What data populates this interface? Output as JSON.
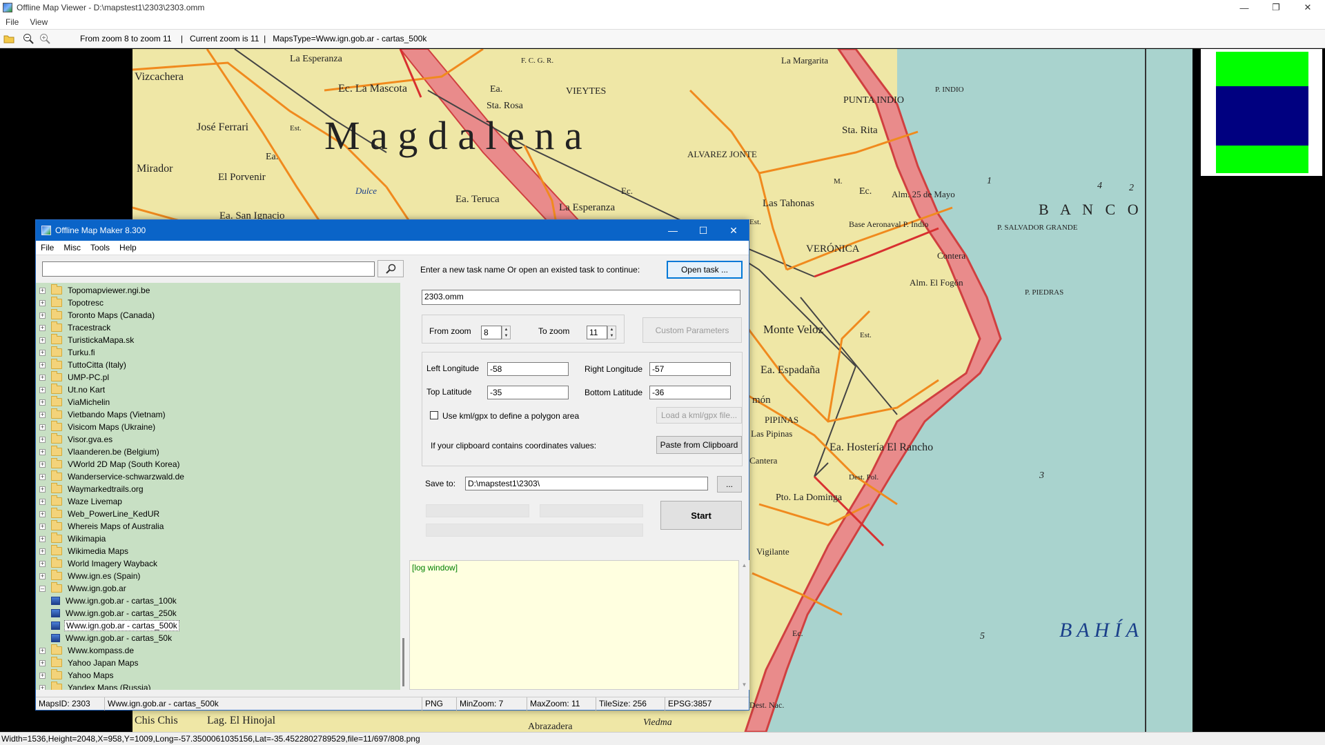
{
  "viewer": {
    "title": "Offline Map Viewer - D:\\mapstest1\\2303\\2303.omm",
    "menu": [
      "File",
      "View"
    ],
    "toolbar_status": "From zoom 8 to zoom 11    |   Current zoom is 11  |   MapsType=Www.ign.gob.ar - cartas_500k",
    "statusbar": "Width=1536,Height=2048,X=958,Y=1009,Long=-57.3500061035156,Lat=-35.4522802789529,file=11/697/808.png"
  },
  "map_labels": {
    "magdalena": "M   a   g   d   a   l   e   n   a",
    "banco": "B  A  N  C  O",
    "bahia": "B  A  H  Í  A",
    "places": [
      "La Esperanza",
      "Vizcachera",
      "Ec. La Mascota",
      "José Ferrari",
      "Mirador",
      "El Porvenir",
      "Ea. San Ignacio",
      "Ea. Teruca",
      "La Esperanza",
      "VIEYTES",
      "Sta. Rosa",
      "Ea.",
      "ALVAREZ JONTE",
      "La Margarita",
      "PUNTA INDIO",
      "P. INDIO",
      "Sta. Rita",
      "Las Tahonas",
      "Ec.",
      "Alm. 25 de Mayo",
      "Base Aeronaval P. Indio",
      "P. SALVADOR GRANDE",
      "VERÓNICA",
      "Contera",
      "Alm. El Fogón",
      "P. PIEDRAS",
      "Monte Veloz",
      "Ea. Espadaña",
      "món",
      "PIPINAS",
      "Las Pipinas",
      "Cantera",
      "Ea. Hostería El Rancho",
      "Dest. Pol.",
      "Pto. La Dominga",
      "Vigilante",
      "Ec.",
      "Chis Chis",
      "Lag. El Hinojal",
      "Abrazadera",
      "Viedma",
      "Dest. Nac.",
      "Dulce",
      "Est.",
      "Est.",
      "Est.",
      "Ea.",
      "Ec.",
      "1",
      "2",
      "3",
      "4",
      "5",
      "M."
    ],
    "ferrocarril": "F. C. G. R."
  },
  "maker": {
    "title": "Offline Map Maker 8.300",
    "menu": [
      "File",
      "Misc",
      "Tools",
      "Help"
    ],
    "tree_items": [
      "Topomapviewer.ngi.be",
      "Topotresc",
      "Toronto Maps (Canada)",
      "Tracestrack",
      "TuristickaMapa.sk",
      "Turku.fi",
      "TuttoCitta (Italy)",
      "UMP-PC.pl",
      "Ut.no Kart",
      "ViaMichelin",
      "Vietbando Maps (Vietnam)",
      "Visicom Maps (Ukraine)",
      "Visor.gva.es",
      "Vlaanderen.be (Belgium)",
      "VWorld 2D Map (South Korea)",
      "Wanderservice-schwarzwald.de",
      "Waymarkedtrails.org",
      "Waze Livemap",
      "Web_PowerLine_KedUR",
      "Whereis Maps of Australia",
      "Wikimapia",
      "Wikimedia Maps",
      "World Imagery Wayback",
      "Www.ign.es (Spain)",
      "Www.ign.gob.ar"
    ],
    "tree_children": [
      "Www.ign.gob.ar - cartas_100k",
      "Www.ign.gob.ar - cartas_250k",
      "Www.ign.gob.ar - cartas_500k",
      "Www.ign.gob.ar - cartas_50k"
    ],
    "tree_items_after": [
      "Www.kompass.de",
      "Yahoo Japan Maps",
      "Yahoo Maps",
      "Yandex Maps (Russia)"
    ],
    "task_prompt": "Enter a new task name Or open an existed task to continue:",
    "open_task_label": "Open task ...",
    "task_name": "2303.omm",
    "from_zoom_label": "From zoom",
    "from_zoom": "8",
    "to_zoom_label": "To zoom",
    "to_zoom": "11",
    "custom_params_label": "Custom Parameters",
    "left_lon_label": "Left Longitude",
    "left_lon": "-58",
    "right_lon_label": "Right Longitude",
    "right_lon": "-57",
    "top_lat_label": "Top Latitude",
    "top_lat": "-35",
    "bottom_lat_label": "Bottom Latitude",
    "bottom_lat": "-36",
    "kml_label": "Use kml/gpx to define a polygon area",
    "load_kml_label": "Load a kml/gpx file...",
    "clipboard_label": "If your clipboard contains coordinates values:",
    "paste_label": "Paste from Clipboard",
    "save_to_label": "Save to:",
    "save_to": "D:\\mapstest1\\2303\\",
    "browse_label": "...",
    "start_label": "Start",
    "log_text": "[log window]",
    "status": {
      "maps_id": "MapsID: 2303",
      "map_name": "Www.ign.gob.ar - cartas_500k",
      "format": "PNG",
      "min_zoom": "MinZoom: 7",
      "max_zoom": "MaxZoom: 11",
      "tile_size": "TileSize: 256",
      "epsg": "EPSG:3857"
    }
  },
  "colors": {
    "map_land": "#efe7a6",
    "map_sea": "#a9d3ce",
    "road_orange": "#f08a1e",
    "coast_red": "#e05a5a",
    "tree_bg": "#c8e0c4",
    "log_bg": "#ffffe0",
    "title_blue": "#0a64c8"
  }
}
